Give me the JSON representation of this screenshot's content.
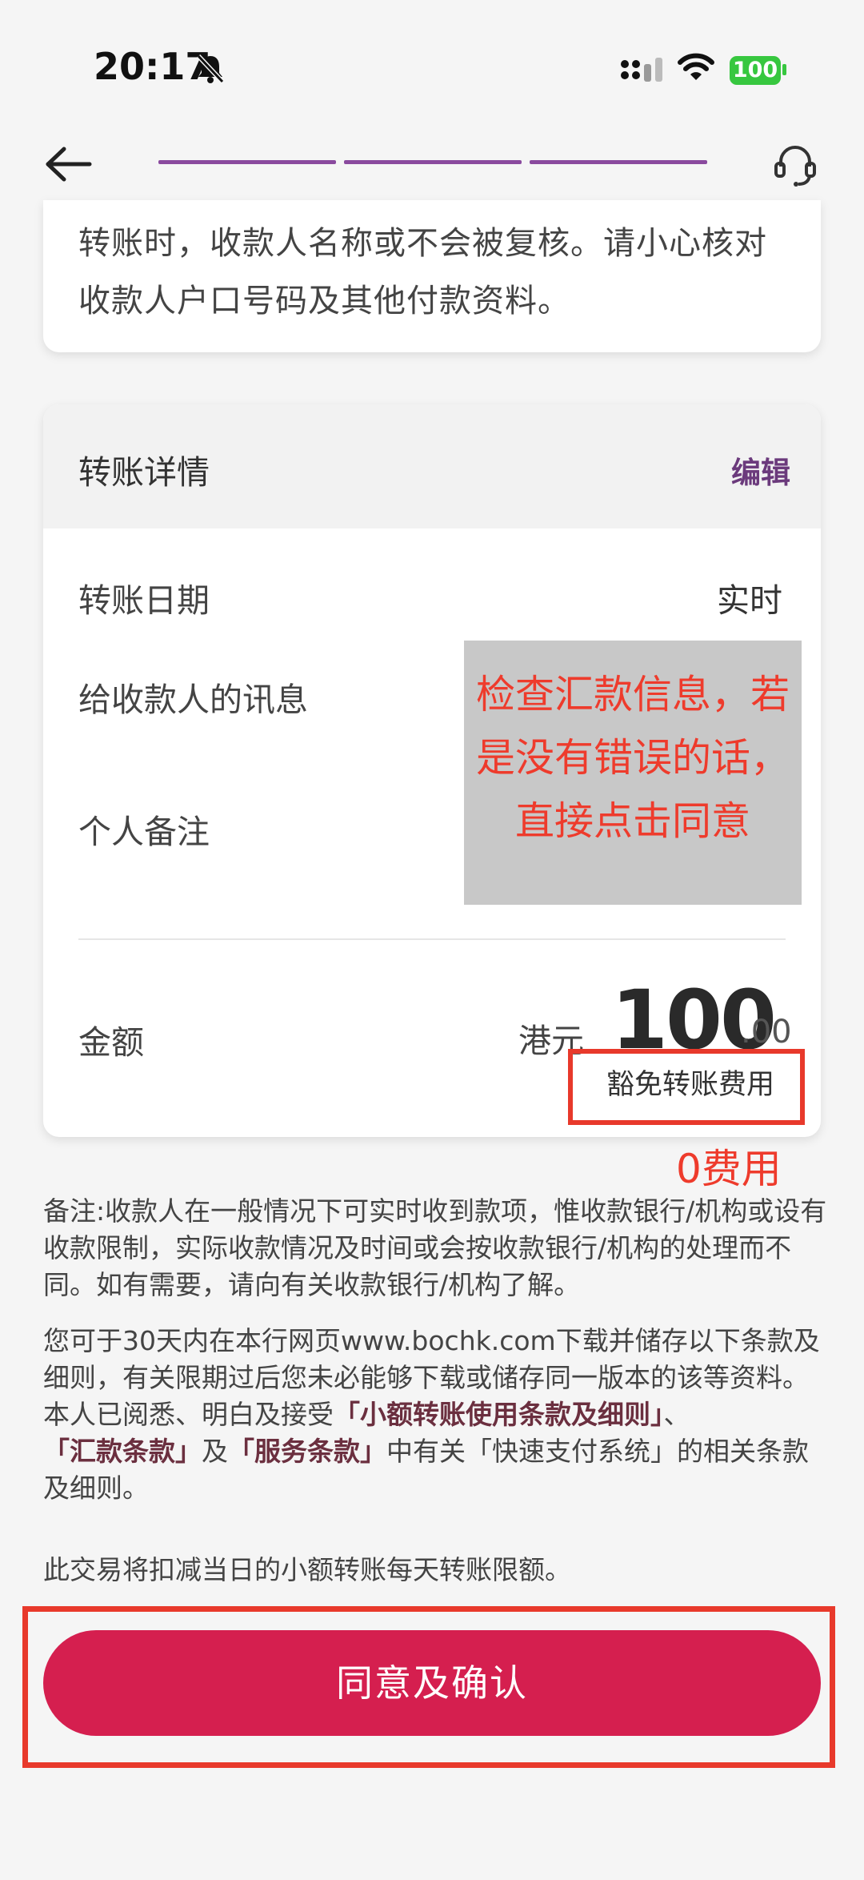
{
  "status_bar": {
    "time": "20:17",
    "battery": "100",
    "icons": [
      "bell-muted-icon",
      "signal-icon",
      "wifi-icon",
      "battery-icon"
    ]
  },
  "header": {
    "back_icon": "back-arrow-icon",
    "support_icon": "headset-icon",
    "progress_steps": 3,
    "progress_completed": 3
  },
  "warning": {
    "text": "转账时，收款人名称或不会被复核。请小心核对收款人户口号码及其他付款资料。"
  },
  "details": {
    "title": "转账详情",
    "edit_label": "编辑",
    "date_label": "转账日期",
    "date_value": "实时",
    "message_label": "给收款人的讯息",
    "note_label": "个人备注",
    "amount_label": "金额",
    "currency": "港元",
    "amount_int": "100",
    "amount_dec": ".00",
    "fee_text": "豁免转账费用"
  },
  "annotations": {
    "overlay_text": "检查汇款信息，若是没有错误的话，直接点击同意",
    "zero_fee": "0费用"
  },
  "notes": {
    "note1": "备注:收款人在一般情况下可实时收到款项，惟收款银行/机构或设有收款限制，实际收款情况及时间或会按收款银行/机构的处理而不同。如有需要，请向有关收款银行/机构了解。",
    "note2_intro": "您可于30天内在本行网页www.bochk.com下载并储存以下条款及细则，有关限期过后您未必能够下载或储存同一版本的该等资料。",
    "note2_read": "本人已阅悉、明白及接受",
    "term1": "「小额转账使用条款及细则」",
    "sep1": "、",
    "term2": "「汇款条款」",
    "sep2": "及",
    "term3": "「服务条款」",
    "note2_tail": "中有关「快速支付系统」的相关条款及细则。",
    "note3": "此交易将扣减当日的小额转账每天转账限额。"
  },
  "confirm_button": "同意及确认",
  "colors": {
    "accent_purple": "#8a4a9e",
    "button": "#d51f4f",
    "annotation_red": "#e8392b"
  }
}
